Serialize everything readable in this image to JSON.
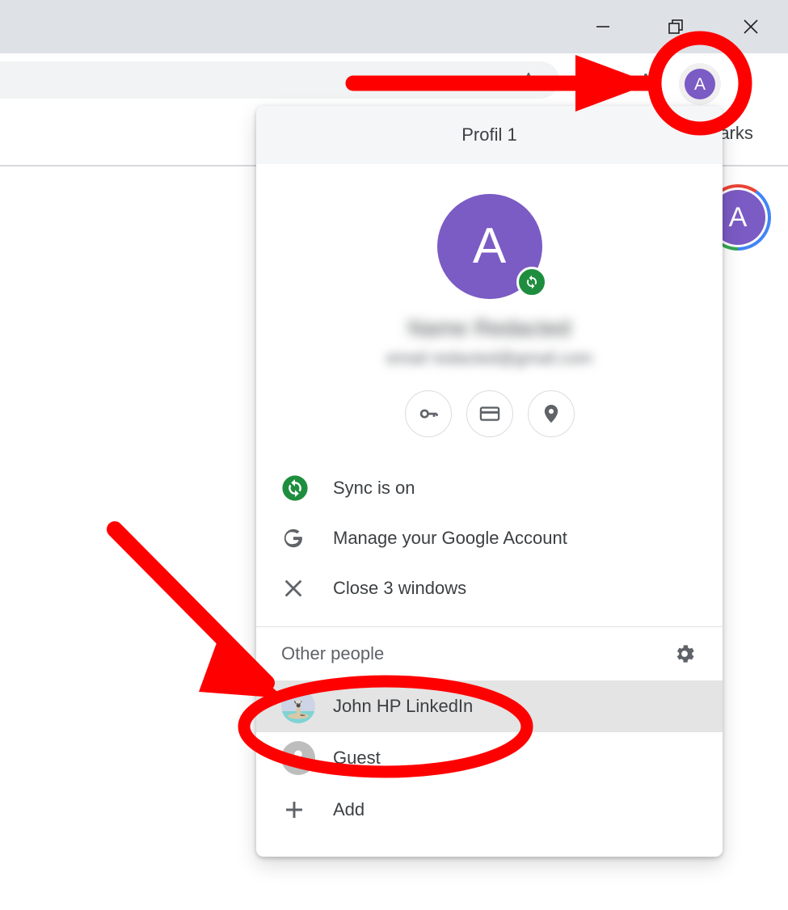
{
  "window": {
    "controls": [
      {
        "name": "minimize",
        "glyph": "minimize-icon"
      },
      {
        "name": "restore",
        "glyph": "restore-icon"
      },
      {
        "name": "close",
        "glyph": "close-icon"
      }
    ]
  },
  "toolbar": {
    "star_icon": "bookmark-star-icon",
    "extensions_icon": "extensions-puzzle-icon",
    "avatar_letter": "A",
    "menu_icon": "three-dot-menu-icon"
  },
  "bookmarks_bar": {
    "label": "marks"
  },
  "page": {
    "account_avatar_letter": "A"
  },
  "popup": {
    "title": "Profil 1",
    "avatar_letter": "A",
    "sync_badge_icon": "sync-icon",
    "account_name": "Name Redacted",
    "account_email": "email redacted@gmail.com",
    "quick_actions": [
      {
        "name": "passwords",
        "icon": "key-icon"
      },
      {
        "name": "payment-methods",
        "icon": "credit-card-icon"
      },
      {
        "name": "addresses",
        "icon": "location-pin-icon"
      }
    ],
    "menu_items": [
      {
        "label": "Sync is on",
        "icon": "sync-icon"
      },
      {
        "label": "Manage your Google Account",
        "icon": "google-g-icon"
      },
      {
        "label": "Close 3 windows",
        "icon": "close-x-icon"
      }
    ],
    "other_people": {
      "title": "Other people",
      "settings_icon": "gear-icon",
      "people": [
        {
          "label": "John HP LinkedIn",
          "avatar": "cat-avatar-icon",
          "highlighted": true
        },
        {
          "label": "Guest",
          "avatar": "person-silhouette-icon",
          "highlighted": false
        }
      ],
      "add": {
        "label": "Add",
        "icon": "plus-icon"
      }
    }
  },
  "annotations": {
    "color": "#FF0000",
    "items": [
      {
        "name": "arrow-to-profile-avatar",
        "type": "arrow-horizontal"
      },
      {
        "name": "circle-around-profile-avatar",
        "type": "ellipse"
      },
      {
        "name": "arrow-to-other-profile",
        "type": "arrow-diagonal"
      },
      {
        "name": "ellipse-around-john-hp-linkedin",
        "type": "ellipse"
      }
    ]
  },
  "colors": {
    "accent_purple": "#7b5bc4",
    "sync_green": "#1e8e3e",
    "annotation_red": "#FF0000",
    "titlebar": "#dee1e6",
    "omnibox": "#f1f3f4",
    "popup_header": "#f5f6f8",
    "highlight_row": "#e4e4e4"
  }
}
